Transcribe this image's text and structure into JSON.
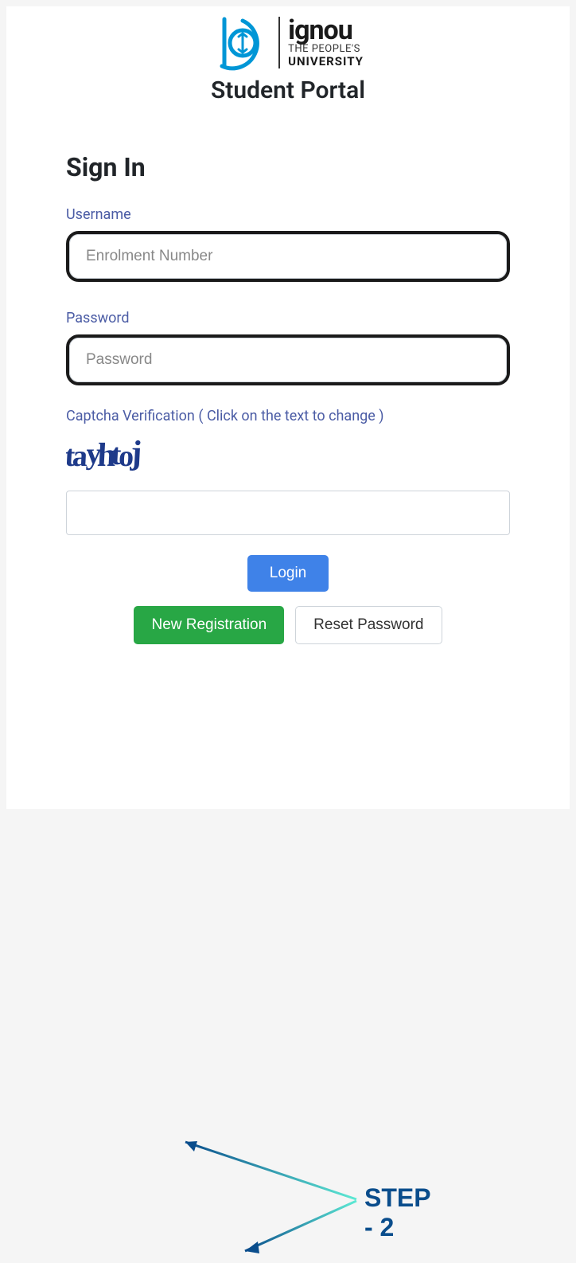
{
  "logo": {
    "brand": "ignou",
    "tagline1": "THE PEOPLE'S",
    "tagline2": "UNIVERSITY"
  },
  "portal_title": "Student Portal",
  "signin": {
    "heading": "Sign In",
    "username_label": "Username",
    "username_placeholder": "Enrolment Number",
    "password_label": "Password",
    "password_placeholder": "Password",
    "captcha_label": "Captcha Verification ( Click on the text to change )",
    "captcha_text": "tayhtoj"
  },
  "buttons": {
    "login": "Login",
    "new_registration": "New Registration",
    "reset_password": "Reset Password"
  },
  "annotation": {
    "step_label": "STEP - 2"
  },
  "colors": {
    "logo_accent": "#0096d6",
    "label_color": "#4b5ca5",
    "login_btn": "#3f82e8",
    "register_btn": "#28a745",
    "annotation_text": "#0a4d8c"
  }
}
